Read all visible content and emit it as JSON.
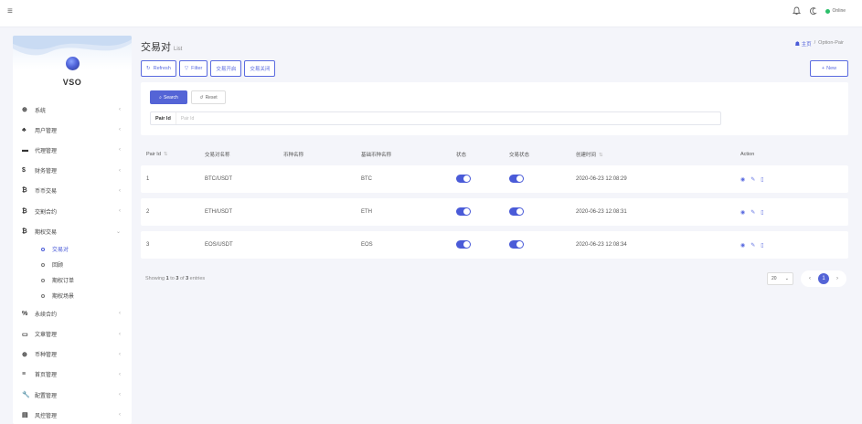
{
  "topbar": {
    "menu_icon": "≡",
    "status_label": "Online"
  },
  "brand": {
    "name": "VSO"
  },
  "sidebar": {
    "items": [
      {
        "icon": "⊕",
        "label": "系统",
        "expanded": false
      },
      {
        "icon": "♣",
        "label": "用户管理",
        "expanded": false
      },
      {
        "icon": "▬",
        "label": "代理管理",
        "expanded": false
      },
      {
        "icon": "$",
        "label": "财务管理",
        "expanded": false
      },
      {
        "icon": "₿",
        "label": "币币交易",
        "expanded": false
      },
      {
        "icon": "₿",
        "label": "交割合约",
        "expanded": false
      },
      {
        "icon": "₿",
        "label": "期权交易",
        "expanded": true
      }
    ],
    "subitems": [
      {
        "label": "交易对",
        "active": true
      },
      {
        "label": "回顾",
        "active": false
      },
      {
        "label": "期权订单",
        "active": false
      },
      {
        "label": "期权场景",
        "active": false
      }
    ],
    "items_after": [
      {
        "icon": "%",
        "label": "永续合约"
      },
      {
        "icon": "▭",
        "label": "文章管理"
      },
      {
        "icon": "⊕",
        "label": "币种管理"
      },
      {
        "icon": "≡",
        "label": "首页管理"
      },
      {
        "icon": "🔧",
        "label": "配置管理"
      },
      {
        "icon": "▤",
        "label": "风控管理"
      }
    ]
  },
  "page": {
    "title": "交易对",
    "subtitle": "List"
  },
  "breadcrumb": {
    "home": "主页",
    "separator": "/",
    "current": "Option-Pair"
  },
  "toolbar": {
    "refresh": "Refresh",
    "filter": "Filter",
    "enable": "交易开启",
    "disable": "交易关闭",
    "new": "New"
  },
  "filter": {
    "search": "Search",
    "reset": "Reset",
    "field_label": "Pair Id",
    "field_placeholder": "Pair Id",
    "field_value": ""
  },
  "table": {
    "headers": [
      "Pair Id",
      "交易对名称",
      "币种名称",
      "基础币种名称",
      "状态",
      "交易状态",
      "创建时间",
      "Action"
    ],
    "rows": [
      {
        "id": "1",
        "pair": "BTC/USDT",
        "coin": "",
        "base": "BTC",
        "status": true,
        "trade_status": true,
        "created": "2020-06-23 12:08:29"
      },
      {
        "id": "2",
        "pair": "ETH/USDT",
        "coin": "",
        "base": "ETH",
        "status": true,
        "trade_status": true,
        "created": "2020-06-23 12:08:31"
      },
      {
        "id": "3",
        "pair": "EOS/USDT",
        "coin": "",
        "base": "EOS",
        "status": true,
        "trade_status": true,
        "created": "2020-06-23 12:08:34"
      }
    ]
  },
  "footer": {
    "showing": "Showing",
    "from": "1",
    "to_word": "to",
    "to": "3",
    "of_word": "of",
    "total": "3",
    "entries": "entries"
  },
  "pagination": {
    "page_size": "20",
    "current_page": "1"
  },
  "colors": {
    "accent": "#5464d6",
    "online": "#2bbf6a",
    "background": "#f4f5fa"
  }
}
